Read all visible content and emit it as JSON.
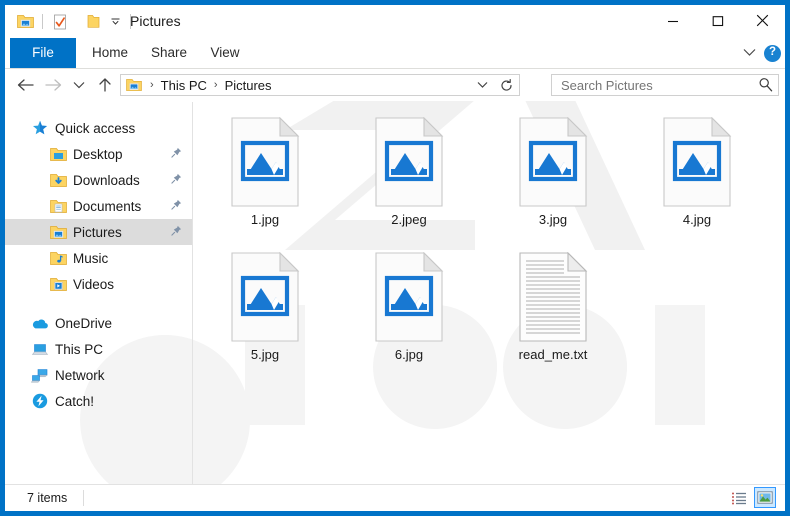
{
  "window": {
    "title": "Pictures",
    "colors": {
      "frame_blue": "#0072c6",
      "accent_blue": "#0078d7",
      "icon_blue": "#1a7fd4",
      "folder_yellow": "#ffd04b",
      "selection_gray": "#dcdcdc"
    },
    "quick_access_toolbar": [
      {
        "name": "pictures-folder-icon",
        "tooltip": "Pictures"
      },
      {
        "name": "properties-icon",
        "tooltip": "Properties"
      },
      {
        "name": "new-folder-icon",
        "tooltip": "New folder"
      },
      {
        "name": "customize-qat-caret-icon",
        "tooltip": "Customize Quick Access Toolbar"
      }
    ],
    "controls": {
      "minimize": "─",
      "maximize": "□",
      "close": "✕"
    }
  },
  "ribbon": {
    "tabs": [
      {
        "label": "File",
        "active": true
      },
      {
        "label": "Home",
        "active": false
      },
      {
        "label": "Share",
        "active": false
      },
      {
        "label": "View",
        "active": false
      }
    ],
    "expand_icon": "chevron-down-icon",
    "help_label": "?"
  },
  "navigation": {
    "back": "←",
    "forward": "→",
    "recent": "⌄",
    "up": "↑",
    "breadcrumb": {
      "icon": "pictures-folder-icon",
      "separator": "›",
      "parts": [
        "This PC",
        "Pictures"
      ]
    },
    "address_dropdown_icon": "chevron-down-icon",
    "refresh_icon": "refresh-icon"
  },
  "search": {
    "placeholder": "Search Pictures",
    "value": "",
    "icon": "search-icon"
  },
  "sidebar": {
    "groups": [
      {
        "header": {
          "label": "Quick access",
          "icon": "star-icon"
        },
        "items": [
          {
            "label": "Desktop",
            "icon": "folder-desktop-icon",
            "pinned": true,
            "selected": false
          },
          {
            "label": "Downloads",
            "icon": "folder-downloads-icon",
            "pinned": true,
            "selected": false
          },
          {
            "label": "Documents",
            "icon": "folder-documents-icon",
            "pinned": true,
            "selected": false
          },
          {
            "label": "Pictures",
            "icon": "folder-pictures-icon",
            "pinned": true,
            "selected": true
          },
          {
            "label": "Music",
            "icon": "folder-music-icon",
            "pinned": false,
            "selected": false
          },
          {
            "label": "Videos",
            "icon": "folder-videos-icon",
            "pinned": false,
            "selected": false
          }
        ]
      },
      {
        "header": null,
        "items": [
          {
            "label": "OneDrive",
            "icon": "onedrive-cloud-icon",
            "pinned": false,
            "selected": false
          },
          {
            "label": "This PC",
            "icon": "this-pc-icon",
            "pinned": false,
            "selected": false
          },
          {
            "label": "Network",
            "icon": "network-icon",
            "pinned": false,
            "selected": false
          },
          {
            "label": "Catch!",
            "icon": "catch-app-icon",
            "pinned": false,
            "selected": false
          }
        ]
      }
    ]
  },
  "files": [
    {
      "name": "1.jpg",
      "type": "image"
    },
    {
      "name": "2.jpeg",
      "type": "image"
    },
    {
      "name": "3.jpg",
      "type": "image"
    },
    {
      "name": "4.jpg",
      "type": "image"
    },
    {
      "name": "5.jpg",
      "type": "image"
    },
    {
      "name": "6.jpg",
      "type": "image"
    },
    {
      "name": "read_me.txt",
      "type": "text"
    }
  ],
  "status_bar": {
    "count_label": "7 items",
    "views": [
      {
        "name": "details-view-button",
        "active": false
      },
      {
        "name": "large-icons-view-button",
        "active": true
      }
    ]
  }
}
